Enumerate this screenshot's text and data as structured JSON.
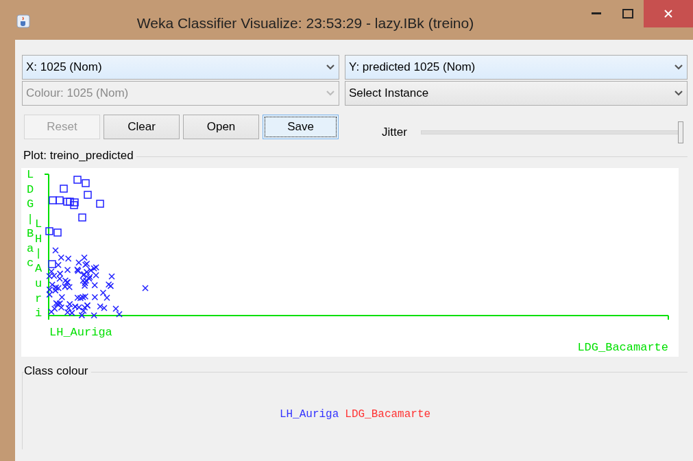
{
  "window": {
    "title": "Weka Classifier Visualize: 23:53:29 - lazy.IBk (treino)"
  },
  "selectors": [
    {
      "label": "X: 1025 (Nom)",
      "disabled": false,
      "highlighted": true
    },
    {
      "label": "Y: predicted 1025 (Nom)",
      "disabled": false,
      "highlighted": true
    },
    {
      "label": "Colour: 1025 (Nom)",
      "disabled": true,
      "highlighted": false
    },
    {
      "label": "Select Instance",
      "disabled": false,
      "highlighted": false
    }
  ],
  "buttons": [
    {
      "label": "Reset",
      "disabled": true,
      "focused": false
    },
    {
      "label": "Clear",
      "disabled": false,
      "focused": false
    },
    {
      "label": "Open",
      "disabled": false,
      "focused": false
    },
    {
      "label": "Save",
      "disabled": false,
      "focused": true
    }
  ],
  "jitter": {
    "label": "Jitter",
    "level": 1
  },
  "plot": {
    "title": "Plot: treino_predicted",
    "x_labels": [
      "LH_Auriga",
      "LDG_Bacamarte"
    ],
    "y_labels": [
      "LDG|Bac",
      "LH|Auri"
    ]
  },
  "class_colour": {
    "title": "Class colour",
    "classes": [
      {
        "name": "LH_Auriga",
        "color": "#3333ff"
      },
      {
        "name": "LDG_Bacamarte",
        "color": "#ff3333"
      }
    ]
  }
}
